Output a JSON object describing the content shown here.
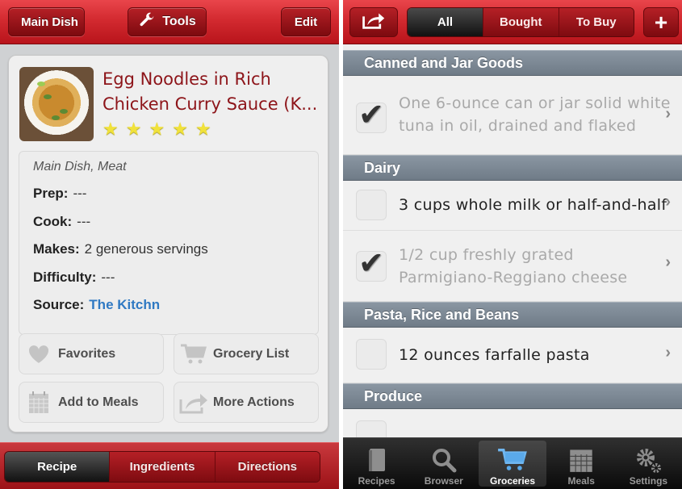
{
  "left": {
    "navbar": {
      "back_label": "Main Dish",
      "tools_label": "Tools",
      "edit_label": "Edit"
    },
    "recipe": {
      "title_line1": "Egg Noodles in Rich",
      "title_line2": "Chicken Curry Sauce (K...",
      "rating": 5,
      "rating_max": 5,
      "category": "Main Dish, Meat",
      "details": [
        {
          "label": "Prep:",
          "value": "---"
        },
        {
          "label": "Cook:",
          "value": "---"
        },
        {
          "label": "Makes:",
          "value": "2 generous servings"
        },
        {
          "label": "Difficulty:",
          "value": "---"
        }
      ],
      "source_label": "Source:",
      "source_value": "The Kitchn"
    },
    "actions": {
      "favorites": "Favorites",
      "grocery_list": "Grocery List",
      "add_to_meals": "Add to Meals",
      "more_actions": "More Actions"
    },
    "segments": [
      {
        "label": "Recipe",
        "active": true
      },
      {
        "label": "Ingredients",
        "active": false
      },
      {
        "label": "Directions",
        "active": false
      }
    ]
  },
  "right": {
    "filters": [
      {
        "label": "All",
        "active": true
      },
      {
        "label": "Bought",
        "active": false
      },
      {
        "label": "To Buy",
        "active": false
      }
    ],
    "sections": [
      {
        "title": "Canned and Jar Goods",
        "items": [
          {
            "line1": "One 6-ounce can or jar solid white",
            "line2": "tuna in oil, drained and flaked",
            "checked": true
          }
        ]
      },
      {
        "title": "Dairy",
        "items": [
          {
            "line1": "3 cups whole milk or half-and-half",
            "line2": "",
            "checked": false
          },
          {
            "line1": "1/2 cup freshly grated",
            "line2": "Parmigiano-Reggiano cheese",
            "checked": true
          }
        ]
      },
      {
        "title": "Pasta, Rice and Beans",
        "items": [
          {
            "line1": "12 ounces farfalle pasta",
            "line2": "",
            "checked": false
          }
        ]
      },
      {
        "title": "Produce",
        "items": []
      }
    ],
    "tabs": [
      {
        "label": "Recipes",
        "icon": "book-icon",
        "active": false
      },
      {
        "label": "Browser",
        "icon": "search-icon",
        "active": false
      },
      {
        "label": "Groceries",
        "icon": "cart-icon",
        "active": true
      },
      {
        "label": "Meals",
        "icon": "calendar-icon",
        "active": false
      },
      {
        "label": "Settings",
        "icon": "gear-icon",
        "active": false
      }
    ]
  }
}
